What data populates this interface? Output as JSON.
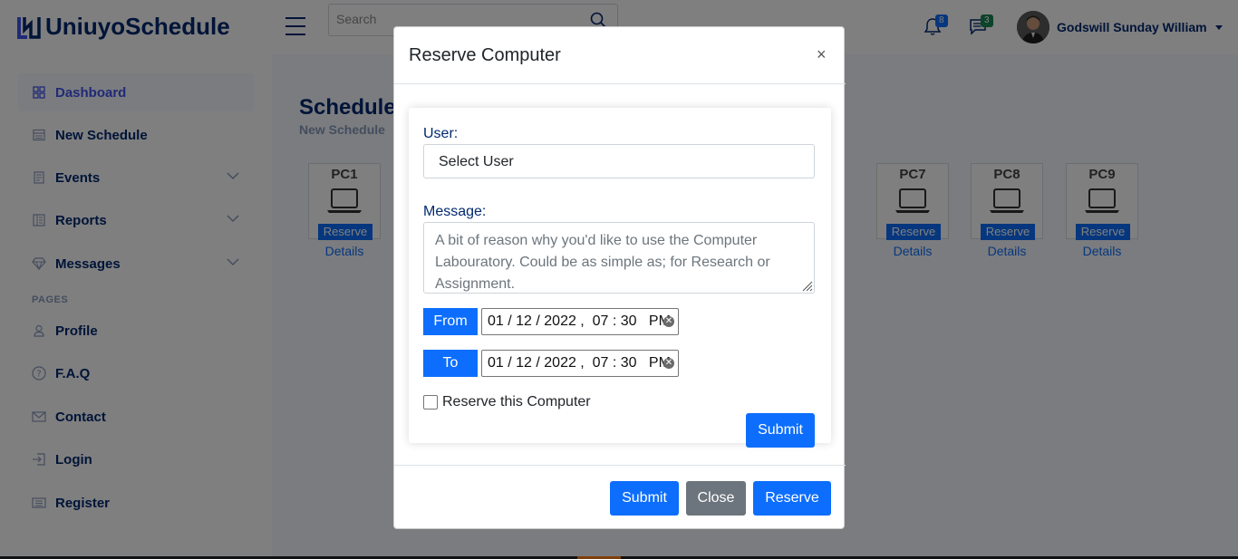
{
  "header": {
    "logo_text": "UniuyoSchedule",
    "search_placeholder": "Search",
    "notifications_count": "8",
    "messages_count": "3",
    "user_name": "Godswill Sunday William"
  },
  "sidebar": {
    "items": [
      {
        "label": "Dashboard",
        "icon": "grid-icon"
      },
      {
        "label": "New Schedule",
        "icon": "menu-button-icon"
      },
      {
        "label": "Events",
        "icon": "journal-icon"
      },
      {
        "label": "Reports",
        "icon": "layout-text-icon"
      },
      {
        "label": "Messages",
        "icon": "gem-icon"
      }
    ],
    "pages_heading": "PAGES",
    "pages": [
      {
        "label": "Profile",
        "icon": "person-icon"
      },
      {
        "label": "F.A.Q",
        "icon": "question-circle-icon"
      },
      {
        "label": "Contact",
        "icon": "envelope-icon"
      },
      {
        "label": "Login",
        "icon": "box-arrow-in-right-icon"
      },
      {
        "label": "Register",
        "icon": "card-list-icon"
      }
    ]
  },
  "main": {
    "page_title": "Schedule",
    "breadcrumb": "New Schedule",
    "computers": [
      {
        "name": "PC1",
        "reserve_label": "Reserve",
        "details_label": "Details"
      },
      {
        "name": "PC7",
        "reserve_label": "Reserve",
        "details_label": "Details"
      },
      {
        "name": "PC8",
        "reserve_label": "Reserve",
        "details_label": "Details"
      },
      {
        "name": "PC9",
        "reserve_label": "Reserve",
        "details_label": "Details"
      }
    ]
  },
  "modal": {
    "title": "Reserve Computer",
    "close_symbol": "×",
    "user_label": "User:",
    "user_select_value": "Select User",
    "message_label": "Message:",
    "message_placeholder": "A bit of reason why you'd like to use the Computer Labouratory. Could be as simple as; for Research or Assignment.",
    "from_label": "From",
    "to_label": "To",
    "from_value": "01 / 12 / 2022 ,  07 : 30   PM",
    "to_value": "01 / 12 / 2022 ,  07 : 30   PM",
    "checkbox_label": "Reserve this Computer",
    "form_submit_label": "Submit",
    "footer_submit_label": "Submit",
    "footer_close_label": "Close",
    "footer_reserve_label": "Reserve"
  },
  "colors": {
    "primary": "#0d6efd",
    "secondary": "#6c757d",
    "brand": "#012970",
    "active_link": "#4154f1"
  }
}
